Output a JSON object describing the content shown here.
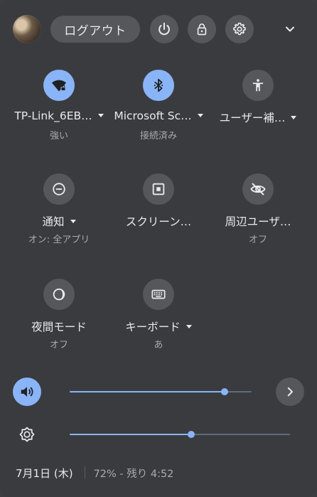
{
  "header": {
    "logout_label": "ログアウト"
  },
  "tiles": [
    {
      "label": "TP-Link_6EB…",
      "sub": "強い",
      "icon": "wifi-secure-icon",
      "active": true,
      "has_menu": true
    },
    {
      "label": "Microsoft Sc…",
      "sub": "接続済み",
      "icon": "bluetooth-icon",
      "active": true,
      "has_menu": true
    },
    {
      "label": "ユーザー補…",
      "sub": "",
      "icon": "accessibility-icon",
      "active": false,
      "has_menu": true
    },
    {
      "label": "通知",
      "sub": "オン: 全アプリ",
      "icon": "notifications-icon",
      "active": false,
      "has_menu": true
    },
    {
      "label": "スクリーン…",
      "sub": "",
      "icon": "screen-capture-icon",
      "active": false,
      "has_menu": false
    },
    {
      "label": "周辺ユーザ…",
      "sub": "オフ",
      "icon": "nearby-share-icon",
      "active": false,
      "has_menu": false
    },
    {
      "label": "夜間モード",
      "sub": "オフ",
      "icon": "night-light-icon",
      "active": false,
      "has_menu": false
    },
    {
      "label": "キーボード",
      "sub": "あ",
      "icon": "keyboard-icon",
      "active": false,
      "has_menu": true
    }
  ],
  "volume": {
    "level": 0.85
  },
  "brightness": {
    "level": 0.55
  },
  "footer": {
    "date": "7月1日 (木)",
    "battery": "72% - 残り 4:52"
  },
  "colors": {
    "accent": "#8ab4f8",
    "panel": "#3a3b3f",
    "button": "#55575b"
  }
}
